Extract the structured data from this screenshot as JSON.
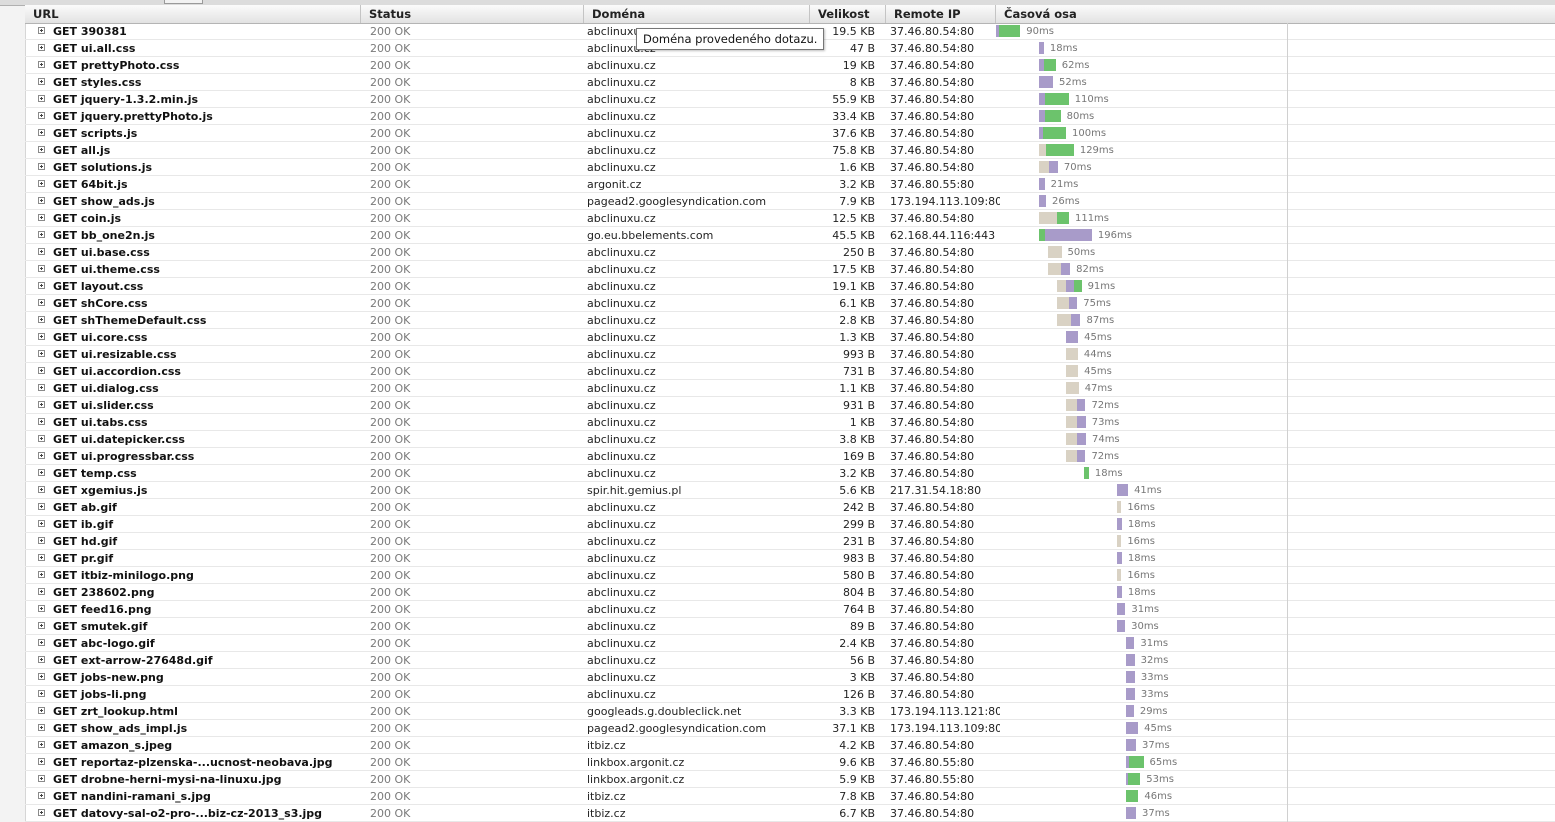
{
  "columns": {
    "url": "URL",
    "status": "Status",
    "domain": "Doména",
    "size": "Velikost",
    "ip": "Remote IP",
    "timeline": "Časová osa"
  },
  "tooltip": "Doména provedeného dotazu.",
  "colors": {
    "blocking": "#d9d2c4",
    "waiting": "#a89bc9",
    "receiving": "#6cc36c"
  },
  "requests": [
    {
      "url": "GET 390381",
      "status": "200 OK",
      "domain": "abclinuxu.cz",
      "size": "19.5 KB",
      "ip": "37.46.80.54:80",
      "time": "90ms",
      "start": 0,
      "segs": [
        {
          "p": "waiting",
          "w": 0.12
        },
        {
          "p": "receiving",
          "w": 0.88
        }
      ]
    },
    {
      "url": "GET ui.all.css",
      "status": "200 OK",
      "domain": "abclinuxu.cz",
      "size": "47 B",
      "ip": "37.46.80.54:80",
      "time": "18ms",
      "start": 43,
      "segs": [
        {
          "p": "waiting",
          "w": 1
        }
      ]
    },
    {
      "url": "GET prettyPhoto.css",
      "status": "200 OK",
      "domain": "abclinuxu.cz",
      "size": "19 KB",
      "ip": "37.46.80.54:80",
      "time": "62ms",
      "start": 43,
      "segs": [
        {
          "p": "waiting",
          "w": 0.3
        },
        {
          "p": "receiving",
          "w": 0.7
        }
      ]
    },
    {
      "url": "GET styles.css",
      "status": "200 OK",
      "domain": "abclinuxu.cz",
      "size": "8 KB",
      "ip": "37.46.80.54:80",
      "time": "52ms",
      "start": 43,
      "segs": [
        {
          "p": "waiting",
          "w": 1
        }
      ]
    },
    {
      "url": "GET jquery-1.3.2.min.js",
      "status": "200 OK",
      "domain": "abclinuxu.cz",
      "size": "55.9 KB",
      "ip": "37.46.80.54:80",
      "time": "110ms",
      "start": 43,
      "segs": [
        {
          "p": "waiting",
          "w": 0.2
        },
        {
          "p": "receiving",
          "w": 0.8
        }
      ]
    },
    {
      "url": "GET jquery.prettyPhoto.js",
      "status": "200 OK",
      "domain": "abclinuxu.cz",
      "size": "33.4 KB",
      "ip": "37.46.80.54:80",
      "time": "80ms",
      "start": 43,
      "segs": [
        {
          "p": "waiting",
          "w": 0.3
        },
        {
          "p": "receiving",
          "w": 0.7
        }
      ]
    },
    {
      "url": "GET scripts.js",
      "status": "200 OK",
      "domain": "abclinuxu.cz",
      "size": "37.6 KB",
      "ip": "37.46.80.54:80",
      "time": "100ms",
      "start": 43,
      "segs": [
        {
          "p": "waiting",
          "w": 0.15
        },
        {
          "p": "receiving",
          "w": 0.85
        }
      ]
    },
    {
      "url": "GET all.js",
      "status": "200 OK",
      "domain": "abclinuxu.cz",
      "size": "75.8 KB",
      "ip": "37.46.80.54:80",
      "time": "129ms",
      "start": 43,
      "segs": [
        {
          "p": "blocking",
          "w": 0.2
        },
        {
          "p": "receiving",
          "w": 0.8
        }
      ]
    },
    {
      "url": "GET solutions.js",
      "status": "200 OK",
      "domain": "abclinuxu.cz",
      "size": "1.6 KB",
      "ip": "37.46.80.54:80",
      "time": "70ms",
      "start": 43,
      "segs": [
        {
          "p": "blocking",
          "w": 0.55
        },
        {
          "p": "waiting",
          "w": 0.45
        }
      ]
    },
    {
      "url": "GET 64bit.js",
      "status": "200 OK",
      "domain": "argonit.cz",
      "size": "3.2 KB",
      "ip": "37.46.80.55:80",
      "time": "21ms",
      "start": 43,
      "segs": [
        {
          "p": "waiting",
          "w": 1
        }
      ]
    },
    {
      "url": "GET show_ads.js",
      "status": "200 OK",
      "domain": "pagead2.googlesyndication.com",
      "size": "7.9 KB",
      "ip": "173.194.113.109:80",
      "time": "26ms",
      "start": 43,
      "segs": [
        {
          "p": "waiting",
          "w": 1
        }
      ]
    },
    {
      "url": "GET coin.js",
      "status": "200 OK",
      "domain": "abclinuxu.cz",
      "size": "12.5 KB",
      "ip": "37.46.80.54:80",
      "time": "111ms",
      "start": 43,
      "segs": [
        {
          "p": "blocking",
          "w": 0.6
        },
        {
          "p": "receiving",
          "w": 0.4
        }
      ]
    },
    {
      "url": "GET bb_one2n.js",
      "status": "200 OK",
      "domain": "go.eu.bbelements.com",
      "size": "45.5 KB",
      "ip": "62.168.44.116:443",
      "time": "196ms",
      "start": 43,
      "segs": [
        {
          "p": "receiving",
          "w": 0.12
        },
        {
          "p": "waiting",
          "w": 0.88
        }
      ]
    },
    {
      "url": "GET ui.base.css",
      "status": "200 OK",
      "domain": "abclinuxu.cz",
      "size": "250 B",
      "ip": "37.46.80.54:80",
      "time": "50ms",
      "start": 52,
      "segs": [
        {
          "p": "blocking",
          "w": 1
        }
      ]
    },
    {
      "url": "GET ui.theme.css",
      "status": "200 OK",
      "domain": "abclinuxu.cz",
      "size": "17.5 KB",
      "ip": "37.46.80.54:80",
      "time": "82ms",
      "start": 52,
      "segs": [
        {
          "p": "blocking",
          "w": 0.6
        },
        {
          "p": "waiting",
          "w": 0.4
        }
      ]
    },
    {
      "url": "GET layout.css",
      "status": "200 OK",
      "domain": "abclinuxu.cz",
      "size": "19.1 KB",
      "ip": "37.46.80.54:80",
      "time": "91ms",
      "start": 61,
      "segs": [
        {
          "p": "blocking",
          "w": 0.35
        },
        {
          "p": "waiting",
          "w": 0.35
        },
        {
          "p": "receiving",
          "w": 0.3
        }
      ]
    },
    {
      "url": "GET shCore.css",
      "status": "200 OK",
      "domain": "abclinuxu.cz",
      "size": "6.1 KB",
      "ip": "37.46.80.54:80",
      "time": "75ms",
      "start": 61,
      "segs": [
        {
          "p": "blocking",
          "w": 0.6
        },
        {
          "p": "waiting",
          "w": 0.4
        }
      ]
    },
    {
      "url": "GET shThemeDefault.css",
      "status": "200 OK",
      "domain": "abclinuxu.cz",
      "size": "2.8 KB",
      "ip": "37.46.80.54:80",
      "time": "87ms",
      "start": 61,
      "segs": [
        {
          "p": "blocking",
          "w": 0.6
        },
        {
          "p": "waiting",
          "w": 0.4
        }
      ]
    },
    {
      "url": "GET ui.core.css",
      "status": "200 OK",
      "domain": "abclinuxu.cz",
      "size": "1.3 KB",
      "ip": "37.46.80.54:80",
      "time": "45ms",
      "start": 70,
      "segs": [
        {
          "p": "waiting",
          "w": 1
        }
      ]
    },
    {
      "url": "GET ui.resizable.css",
      "status": "200 OK",
      "domain": "abclinuxu.cz",
      "size": "993 B",
      "ip": "37.46.80.54:80",
      "time": "44ms",
      "start": 70,
      "segs": [
        {
          "p": "blocking",
          "w": 1
        }
      ]
    },
    {
      "url": "GET ui.accordion.css",
      "status": "200 OK",
      "domain": "abclinuxu.cz",
      "size": "731 B",
      "ip": "37.46.80.54:80",
      "time": "45ms",
      "start": 70,
      "segs": [
        {
          "p": "blocking",
          "w": 1
        }
      ]
    },
    {
      "url": "GET ui.dialog.css",
      "status": "200 OK",
      "domain": "abclinuxu.cz",
      "size": "1.1 KB",
      "ip": "37.46.80.54:80",
      "time": "47ms",
      "start": 70,
      "segs": [
        {
          "p": "blocking",
          "w": 1
        }
      ]
    },
    {
      "url": "GET ui.slider.css",
      "status": "200 OK",
      "domain": "abclinuxu.cz",
      "size": "931 B",
      "ip": "37.46.80.54:80",
      "time": "72ms",
      "start": 70,
      "segs": [
        {
          "p": "blocking",
          "w": 0.55
        },
        {
          "p": "waiting",
          "w": 0.45
        }
      ]
    },
    {
      "url": "GET ui.tabs.css",
      "status": "200 OK",
      "domain": "abclinuxu.cz",
      "size": "1 KB",
      "ip": "37.46.80.54:80",
      "time": "73ms",
      "start": 70,
      "segs": [
        {
          "p": "blocking",
          "w": 0.55
        },
        {
          "p": "waiting",
          "w": 0.45
        }
      ]
    },
    {
      "url": "GET ui.datepicker.css",
      "status": "200 OK",
      "domain": "abclinuxu.cz",
      "size": "3.8 KB",
      "ip": "37.46.80.54:80",
      "time": "74ms",
      "start": 70,
      "segs": [
        {
          "p": "blocking",
          "w": 0.55
        },
        {
          "p": "waiting",
          "w": 0.45
        }
      ]
    },
    {
      "url": "GET ui.progressbar.css",
      "status": "200 OK",
      "domain": "abclinuxu.cz",
      "size": "169 B",
      "ip": "37.46.80.54:80",
      "time": "72ms",
      "start": 70,
      "segs": [
        {
          "p": "blocking",
          "w": 0.55
        },
        {
          "p": "waiting",
          "w": 0.45
        }
      ]
    },
    {
      "url": "GET temp.css",
      "status": "200 OK",
      "domain": "abclinuxu.cz",
      "size": "3.2 KB",
      "ip": "37.46.80.54:80",
      "time": "18ms",
      "start": 88,
      "segs": [
        {
          "p": "receiving",
          "w": 1
        }
      ]
    },
    {
      "url": "GET xgemius.js",
      "status": "200 OK",
      "domain": "spir.hit.gemius.pl",
      "size": "5.6 KB",
      "ip": "217.31.54.18:80",
      "time": "41ms",
      "start": 121,
      "segs": [
        {
          "p": "waiting",
          "w": 1
        }
      ]
    },
    {
      "url": "GET ab.gif",
      "status": "200 OK",
      "domain": "abclinuxu.cz",
      "size": "242 B",
      "ip": "37.46.80.54:80",
      "time": "16ms",
      "start": 121,
      "segs": [
        {
          "p": "blocking",
          "w": 1
        }
      ]
    },
    {
      "url": "GET ib.gif",
      "status": "200 OK",
      "domain": "abclinuxu.cz",
      "size": "299 B",
      "ip": "37.46.80.54:80",
      "time": "18ms",
      "start": 121,
      "segs": [
        {
          "p": "waiting",
          "w": 1
        }
      ]
    },
    {
      "url": "GET hd.gif",
      "status": "200 OK",
      "domain": "abclinuxu.cz",
      "size": "231 B",
      "ip": "37.46.80.54:80",
      "time": "16ms",
      "start": 121,
      "segs": [
        {
          "p": "blocking",
          "w": 1
        }
      ]
    },
    {
      "url": "GET pr.gif",
      "status": "200 OK",
      "domain": "abclinuxu.cz",
      "size": "983 B",
      "ip": "37.46.80.54:80",
      "time": "18ms",
      "start": 121,
      "segs": [
        {
          "p": "waiting",
          "w": 1
        }
      ]
    },
    {
      "url": "GET itbiz-minilogo.png",
      "status": "200 OK",
      "domain": "abclinuxu.cz",
      "size": "580 B",
      "ip": "37.46.80.54:80",
      "time": "16ms",
      "start": 121,
      "segs": [
        {
          "p": "blocking",
          "w": 1
        }
      ]
    },
    {
      "url": "GET 238602.png",
      "status": "200 OK",
      "domain": "abclinuxu.cz",
      "size": "804 B",
      "ip": "37.46.80.54:80",
      "time": "18ms",
      "start": 121,
      "segs": [
        {
          "p": "waiting",
          "w": 1
        }
      ]
    },
    {
      "url": "GET feed16.png",
      "status": "200 OK",
      "domain": "abclinuxu.cz",
      "size": "764 B",
      "ip": "37.46.80.54:80",
      "time": "31ms",
      "start": 121,
      "segs": [
        {
          "p": "waiting",
          "w": 1
        }
      ]
    },
    {
      "url": "GET smutek.gif",
      "status": "200 OK",
      "domain": "abclinuxu.cz",
      "size": "89 B",
      "ip": "37.46.80.54:80",
      "time": "30ms",
      "start": 121,
      "segs": [
        {
          "p": "waiting",
          "w": 1
        }
      ]
    },
    {
      "url": "GET abc-logo.gif",
      "status": "200 OK",
      "domain": "abclinuxu.cz",
      "size": "2.4 KB",
      "ip": "37.46.80.54:80",
      "time": "31ms",
      "start": 130,
      "segs": [
        {
          "p": "waiting",
          "w": 1
        }
      ]
    },
    {
      "url": "GET ext-arrow-27648d.gif",
      "status": "200 OK",
      "domain": "abclinuxu.cz",
      "size": "56 B",
      "ip": "37.46.80.54:80",
      "time": "32ms",
      "start": 130,
      "segs": [
        {
          "p": "waiting",
          "w": 1
        }
      ]
    },
    {
      "url": "GET jobs-new.png",
      "status": "200 OK",
      "domain": "abclinuxu.cz",
      "size": "3 KB",
      "ip": "37.46.80.54:80",
      "time": "33ms",
      "start": 130,
      "segs": [
        {
          "p": "waiting",
          "w": 1
        }
      ]
    },
    {
      "url": "GET jobs-li.png",
      "status": "200 OK",
      "domain": "abclinuxu.cz",
      "size": "126 B",
      "ip": "37.46.80.54:80",
      "time": "33ms",
      "start": 130,
      "segs": [
        {
          "p": "waiting",
          "w": 1
        }
      ]
    },
    {
      "url": "GET zrt_lookup.html",
      "status": "200 OK",
      "domain": "googleads.g.doubleclick.net",
      "size": "3.3 KB",
      "ip": "173.194.113.121:80",
      "time": "29ms",
      "start": 130,
      "segs": [
        {
          "p": "waiting",
          "w": 1
        }
      ]
    },
    {
      "url": "GET show_ads_impl.js",
      "status": "200 OK",
      "domain": "pagead2.googlesyndication.com",
      "size": "37.1 KB",
      "ip": "173.194.113.109:80",
      "time": "45ms",
      "start": 130,
      "segs": [
        {
          "p": "waiting",
          "w": 1
        }
      ]
    },
    {
      "url": "GET amazon_s.jpeg",
      "status": "200 OK",
      "domain": "itbiz.cz",
      "size": "4.2 KB",
      "ip": "37.46.80.54:80",
      "time": "37ms",
      "start": 130,
      "segs": [
        {
          "p": "waiting",
          "w": 1
        }
      ]
    },
    {
      "url": "GET reportaz-plzenska-...ucnost-neobava.jpg",
      "status": "200 OK",
      "domain": "linkbox.argonit.cz",
      "size": "9.6 KB",
      "ip": "37.46.80.55:80",
      "time": "65ms",
      "start": 130,
      "segs": [
        {
          "p": "waiting",
          "w": 0.15
        },
        {
          "p": "receiving",
          "w": 0.85
        }
      ]
    },
    {
      "url": "GET drobne-herni-mysi-na-linuxu.jpg",
      "status": "200 OK",
      "domain": "linkbox.argonit.cz",
      "size": "5.9 KB",
      "ip": "37.46.80.55:80",
      "time": "53ms",
      "start": 130,
      "segs": [
        {
          "p": "waiting",
          "w": 0.15
        },
        {
          "p": "receiving",
          "w": 0.85
        }
      ]
    },
    {
      "url": "GET nandini-ramani_s.jpg",
      "status": "200 OK",
      "domain": "itbiz.cz",
      "size": "7.8 KB",
      "ip": "37.46.80.54:80",
      "time": "46ms",
      "start": 130,
      "segs": [
        {
          "p": "receiving",
          "w": 1
        }
      ]
    },
    {
      "url": "GET datovy-sal-o2-pro-...biz-cz-2013_s3.jpg",
      "status": "200 OK",
      "domain": "itbiz.cz",
      "size": "6.7 KB",
      "ip": "37.46.80.54:80",
      "time": "37ms",
      "start": 130,
      "segs": [
        {
          "p": "waiting",
          "w": 1
        }
      ]
    }
  ]
}
